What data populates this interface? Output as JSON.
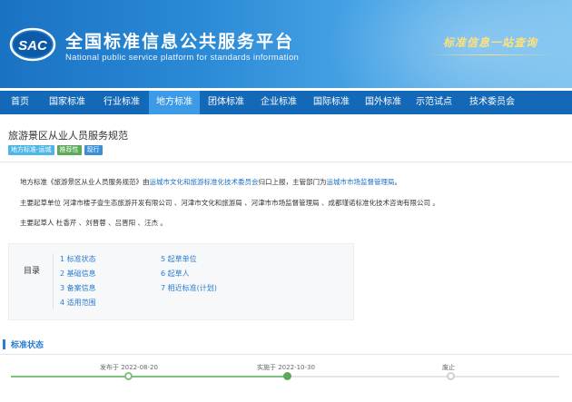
{
  "header": {
    "logo_text": "SAC",
    "title_cn": "全国标准信息公共服务平台",
    "title_en": "National public service platform  for standards information",
    "slogan": "标准信息一站查询"
  },
  "nav": {
    "items": [
      {
        "label": "首页",
        "active": false
      },
      {
        "label": "国家标准",
        "active": false
      },
      {
        "label": "行业标准",
        "active": false
      },
      {
        "label": "地方标准",
        "active": true
      },
      {
        "label": "团体标准",
        "active": false
      },
      {
        "label": "企业标准",
        "active": false
      },
      {
        "label": "国际标准",
        "active": false
      },
      {
        "label": "国外标准",
        "active": false
      },
      {
        "label": "示范试点",
        "active": false
      },
      {
        "label": "技术委员会",
        "active": false
      }
    ]
  },
  "standard": {
    "title": "旅游景区从业人员服务规范",
    "badges": [
      "地方标准-运城",
      "推荐性",
      "现行"
    ]
  },
  "description": {
    "line1_prefix": "地方标准《旅游景区从业人员服务规范》由",
    "line1_link1": "运城市文化和旅游标准化技术委员会",
    "line1_middle": "归口上报，主管部门为",
    "line1_link2": "运城市市场监督管理局",
    "line1_suffix": "。",
    "line2": "主要起草单位 河津市楼子壹生态旅游开发有限公司 、河津市文化和旅游局 、河津市市场监督管理局 、成都瑾诺标准化技术咨询有限公司 。",
    "line3": "主要起草人 杜香芹 、刘晋蓉 、吕晋阳 、汪杰 。"
  },
  "toc": {
    "label": "目录",
    "items_left": [
      "1  标准状态",
      "2  基础信息",
      "3  备案信息",
      "4  适用范围"
    ],
    "items_right": [
      "5  起草单位",
      "6  起草人",
      "7  相近标准(计划)"
    ]
  },
  "status": {
    "title": "标准状态",
    "published": "发布于 2022-08-20",
    "implemented": "实施于 2022-10-30",
    "abolished": "废止"
  },
  "colors": {
    "nav_bg": "#1468b8",
    "nav_active": "#3d9ae6",
    "link": "#1e6fc4",
    "timeline_green": "#7cc27c"
  }
}
